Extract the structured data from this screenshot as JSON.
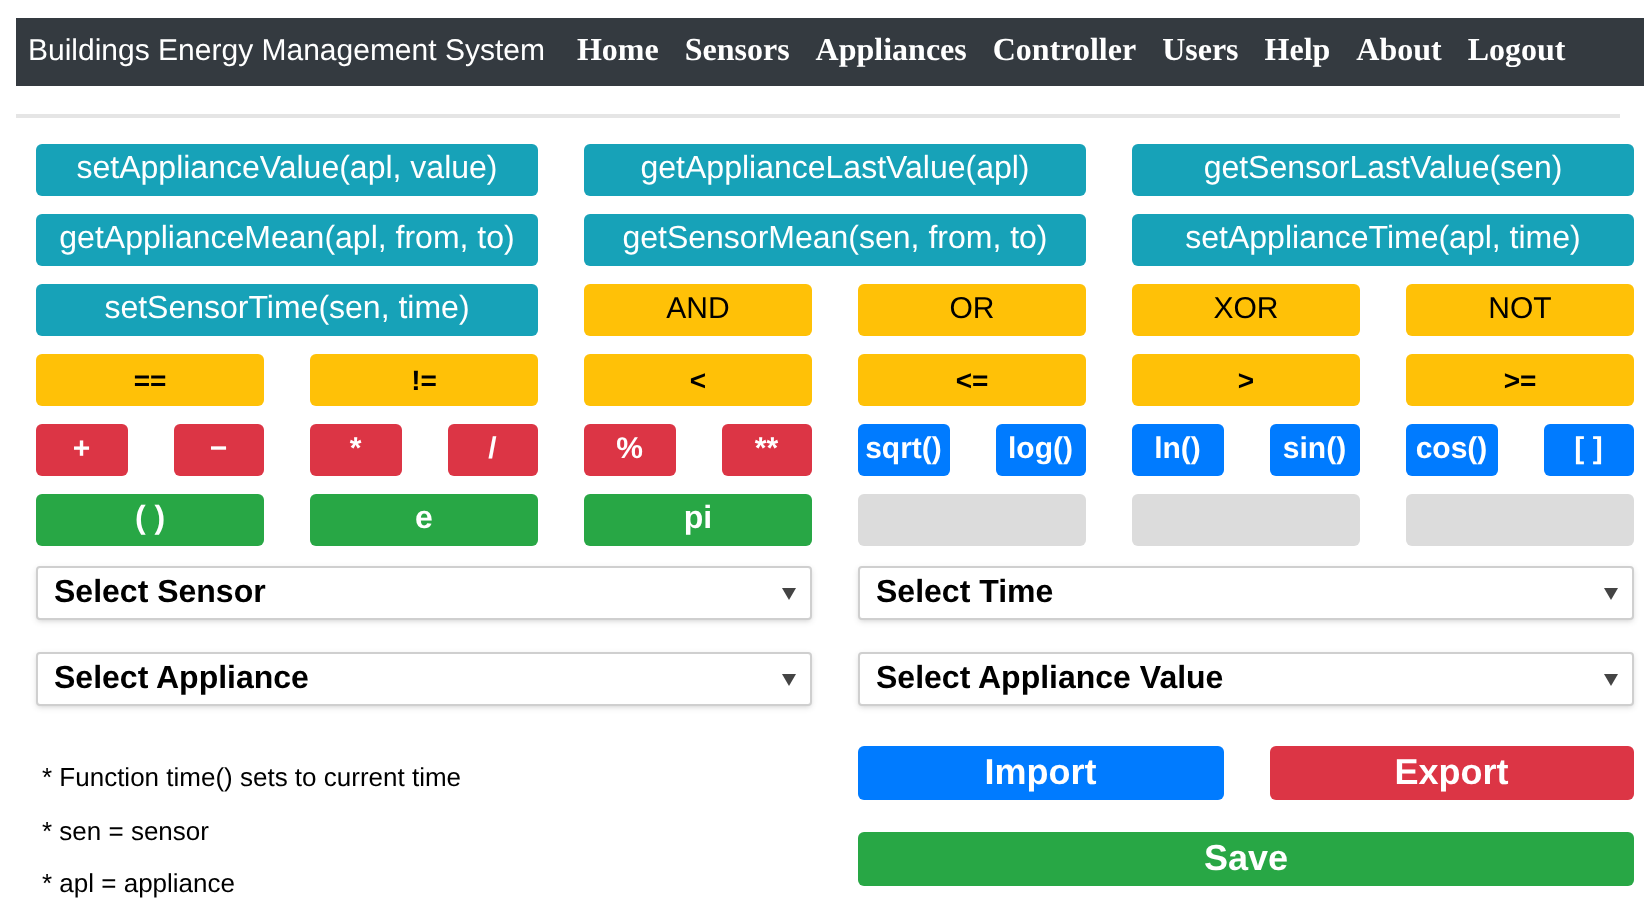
{
  "navbar": {
    "title": "Buildings Energy Management System",
    "links": [
      {
        "label": "Home"
      },
      {
        "label": "Sensors"
      },
      {
        "label": "Appliances"
      },
      {
        "label": "Controller"
      },
      {
        "label": "Users"
      },
      {
        "label": "Help"
      },
      {
        "label": "About"
      },
      {
        "label": "Logout"
      }
    ]
  },
  "palette": [
    {
      "kind": "function",
      "label": "setApplianceValue(apl, value)"
    },
    {
      "kind": "function",
      "label": "getApplianceLastValue(apl)"
    },
    {
      "kind": "function",
      "label": "getSensorLastValue(sen)"
    },
    {
      "kind": "function",
      "label": "getApplianceMean(apl, from, to)"
    },
    {
      "kind": "function",
      "label": "getSensorMean(sen, from, to)"
    },
    {
      "kind": "function",
      "label": "setApplianceTime(apl, time)"
    },
    {
      "kind": "function",
      "label": "setSensorTime(sen, time)"
    },
    {
      "kind": "logic",
      "label": "AND"
    },
    {
      "kind": "logic",
      "label": "OR"
    },
    {
      "kind": "logic",
      "label": "XOR"
    },
    {
      "kind": "logic",
      "label": "NOT"
    },
    {
      "kind": "compare",
      "label": "=="
    },
    {
      "kind": "compare",
      "label": "!="
    },
    {
      "kind": "compare",
      "label": "<"
    },
    {
      "kind": "compare",
      "label": "<="
    },
    {
      "kind": "compare",
      "label": ">"
    },
    {
      "kind": "compare",
      "label": ">="
    },
    {
      "kind": "operator",
      "label": "+"
    },
    {
      "kind": "operator",
      "label": "−"
    },
    {
      "kind": "operator",
      "label": "*"
    },
    {
      "kind": "operator",
      "label": "/"
    },
    {
      "kind": "operator",
      "label": "%"
    },
    {
      "kind": "operator",
      "label": "**"
    },
    {
      "kind": "math",
      "label": "sqrt()"
    },
    {
      "kind": "math",
      "label": "log()"
    },
    {
      "kind": "math",
      "label": "ln()"
    },
    {
      "kind": "math",
      "label": "sin()"
    },
    {
      "kind": "math",
      "label": "cos()"
    },
    {
      "kind": "math",
      "label": "[ ]"
    },
    {
      "kind": "constant",
      "label": "( )"
    },
    {
      "kind": "constant",
      "label": "e"
    },
    {
      "kind": "constant",
      "label": "pi"
    },
    {
      "kind": "empty"
    },
    {
      "kind": "empty"
    },
    {
      "kind": "empty"
    }
  ],
  "selects": [
    {
      "placeholder": "Select Sensor"
    },
    {
      "placeholder": "Select Time"
    },
    {
      "placeholder": "Select Appliance"
    },
    {
      "placeholder": "Select Appliance Value"
    }
  ],
  "notes": [
    "* Function time() sets to current time",
    "* sen = sensor",
    "* apl = appliance"
  ],
  "actions": [
    {
      "kind": "import",
      "label": "Import"
    },
    {
      "kind": "export",
      "label": "Export"
    },
    {
      "kind": "save",
      "label": "Save"
    }
  ]
}
